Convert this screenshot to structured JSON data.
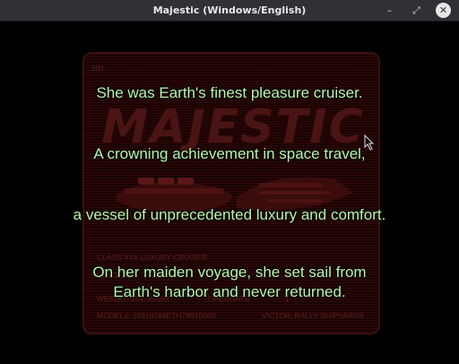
{
  "window": {
    "title": "Majestic (Windows/English)",
    "min_glyph": "–",
    "max_glyph": "⤢",
    "close_glyph": "✕"
  },
  "card": {
    "number": "100",
    "logo": "MAJESTIC",
    "class_line": "CLASS XVII LUXURY CRUISER",
    "row1_left": "LENGTH:",
    "row1_mid": "SPEED:",
    "row2_left": "WEIGHT:  154, 800mt",
    "row2_mid": "LIFEBOATS:",
    "row2_right": "1",
    "model": "MODEL#: 10918289ETH7891026X",
    "maker": "VICTOR, RALLY SHIPYARDS"
  },
  "captions": {
    "line1": "She was Earth's finest pleasure cruiser.",
    "line2": "A crowning achievement in space travel,",
    "line3": "a vessel of unprecedented luxury and comfort.",
    "line4a": "On her maiden voyage, she set sail from",
    "line4b": "Earth's harbor and never returned."
  },
  "colors": {
    "caption": "#b9f5a8",
    "card_bg": "#1a0404",
    "titlebar": "#2f3136"
  }
}
